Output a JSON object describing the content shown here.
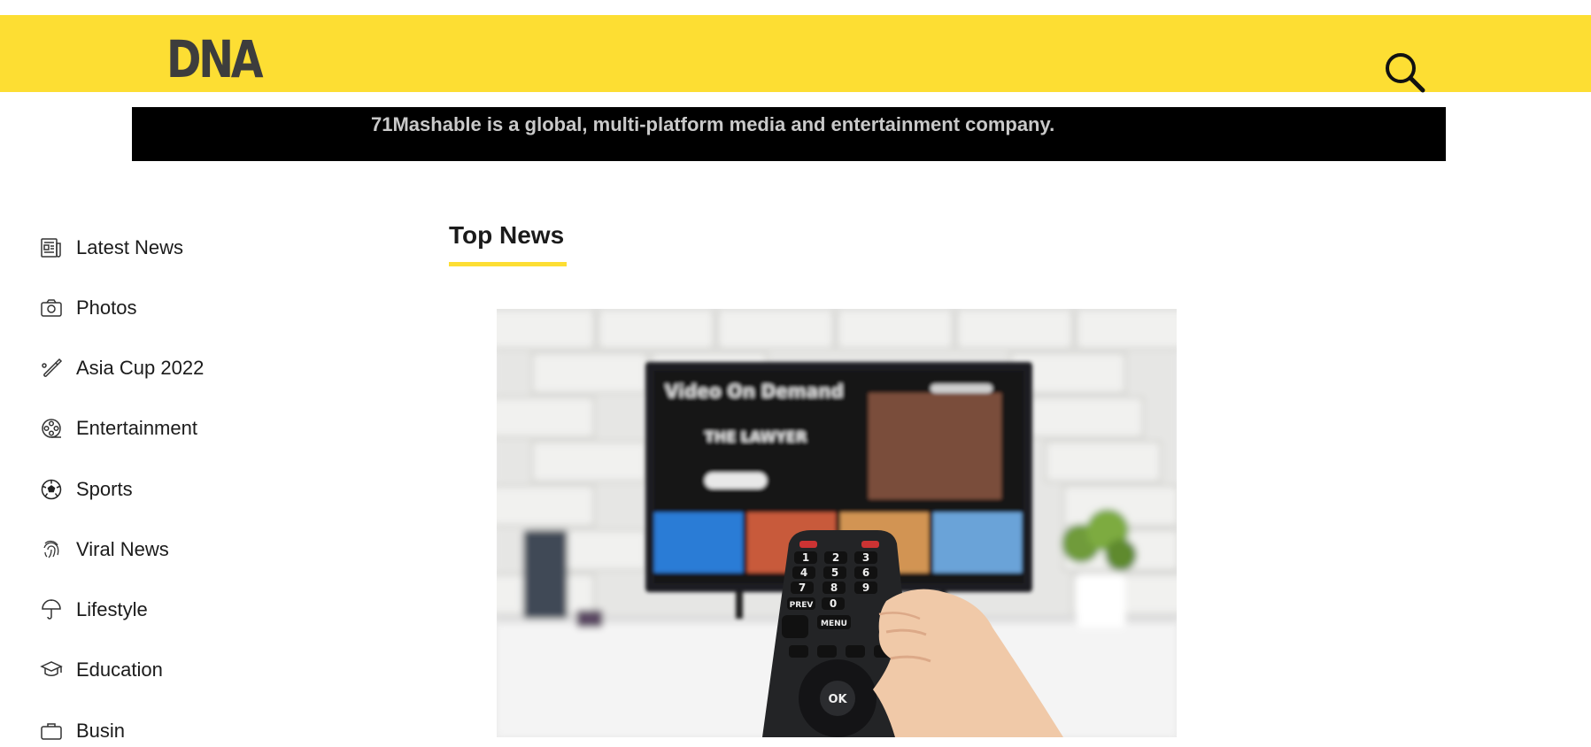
{
  "header": {
    "logo_text": "DNA",
    "search_icon": "search-icon",
    "colors": {
      "bar": "#fdde33",
      "logo": "#3d3d3d"
    }
  },
  "banner": {
    "text": "71Mashable is a global, multi-platform media and entertainment company.",
    "colors": {
      "background": "#000000",
      "text": "#c9c9c9"
    }
  },
  "sidebar": {
    "items": [
      {
        "label": "Latest News",
        "icon": "newspaper-icon"
      },
      {
        "label": "Photos",
        "icon": "camera-icon"
      },
      {
        "label": "Asia Cup 2022",
        "icon": "cricket-bat-icon"
      },
      {
        "label": "Entertainment",
        "icon": "film-reel-icon"
      },
      {
        "label": "Sports",
        "icon": "football-icon"
      },
      {
        "label": "Viral News",
        "icon": "fingerprint-icon"
      },
      {
        "label": "Lifestyle",
        "icon": "umbrella-icon"
      },
      {
        "label": "Education",
        "icon": "graduation-cap-icon"
      },
      {
        "label": "Busin",
        "icon": "briefcase-icon"
      }
    ]
  },
  "main": {
    "section_title": "Top News",
    "accent_color": "#fdde33",
    "hero_image": {
      "tv_title": "Video On Demand",
      "tile_title": "THE LAWYER",
      "remote_keys": [
        "1",
        "2",
        "3",
        "4",
        "5",
        "6",
        "7",
        "8",
        "9",
        "PREV",
        "0",
        "MENU",
        "OK"
      ]
    }
  }
}
